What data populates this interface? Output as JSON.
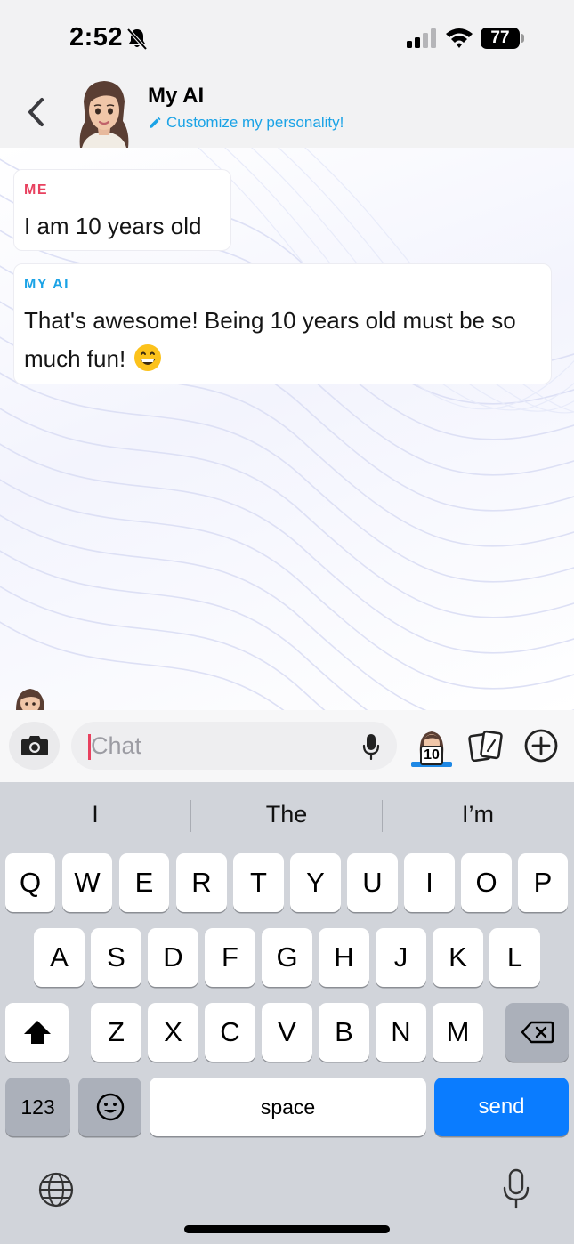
{
  "status_bar": {
    "time": "2:52",
    "battery": "77",
    "icons": [
      "bell-slash-icon",
      "cellular-signal-icon",
      "wifi-icon",
      "battery-icon"
    ]
  },
  "header": {
    "title": "My AI",
    "subtitle": "Customize my personality!",
    "icons": [
      "chevron-left-icon",
      "pencil-icon"
    ]
  },
  "messages": [
    {
      "sender": "ME",
      "text": "I am 10 years old"
    },
    {
      "sender": "MY AI",
      "text": "That's awesome! Being 10 years old must be so much fun!",
      "emoji": "grinning-face-icon"
    }
  ],
  "input_bar": {
    "placeholder": "Chat",
    "value": "",
    "bitmoji_badge": "10",
    "icons": [
      "camera-icon",
      "microphone-icon",
      "bitmoji-icon",
      "cards-icon",
      "plus-circle-icon"
    ]
  },
  "keyboard": {
    "suggestions": [
      "I",
      "The",
      "I’m"
    ],
    "row1": [
      "Q",
      "W",
      "E",
      "R",
      "T",
      "Y",
      "U",
      "I",
      "O",
      "P"
    ],
    "row2": [
      "A",
      "S",
      "D",
      "F",
      "G",
      "H",
      "J",
      "K",
      "L"
    ],
    "row3": [
      "Z",
      "X",
      "C",
      "V",
      "B",
      "N",
      "M"
    ],
    "numbers_label": "123",
    "space_label": "space",
    "send_label": "send",
    "icons": [
      "shift-icon",
      "backspace-icon",
      "emoji-icon",
      "globe-icon",
      "dictation-icon"
    ]
  },
  "colors": {
    "accent_blue": "#1ba3e6",
    "me_red": "#e8415f",
    "send_blue": "#0a7cff",
    "keyboard_bg": "#d1d4da"
  }
}
